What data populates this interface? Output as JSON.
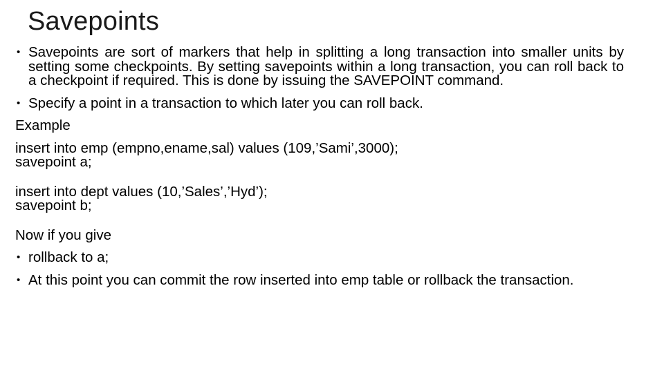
{
  "slide": {
    "title": "Savepoints",
    "bullets_top": [
      "Savepoints are sort of markers that help in splitting a long transaction into smaller units by setting some checkpoints. By setting savepoints within a long transaction, you can roll back to a checkpoint if required. This is done by issuing the SAVEPOINT command.",
      "Specify a point in a transaction to which later you can roll back."
    ],
    "example_label": "Example",
    "code_block_1": [
      "insert into emp (empno,ename,sal) values (109,’Sami’,3000);",
      "savepoint a;"
    ],
    "code_block_2": [
      "insert into dept values (10,’Sales’,’Hyd’);",
      "savepoint b;"
    ],
    "now_label": "Now if you give",
    "bullets_bottom": [
      "rollback to a;",
      "At this point you can commit the row inserted into emp table or rollback the transaction."
    ]
  }
}
